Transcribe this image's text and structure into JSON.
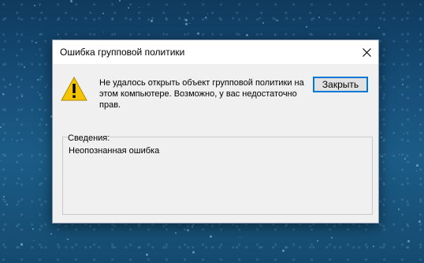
{
  "dialog": {
    "title": "Ошибка групповой политики",
    "message": "Не удалось открыть объект групповой политики на этом компьютере. Возможно, у вас недостаточно прав.",
    "close_button_label": "Закрыть",
    "details_label": "Сведения:",
    "details_text": "Неопознанная ошибка",
    "icon": "warning-icon",
    "accent_color": "#0078d7"
  }
}
